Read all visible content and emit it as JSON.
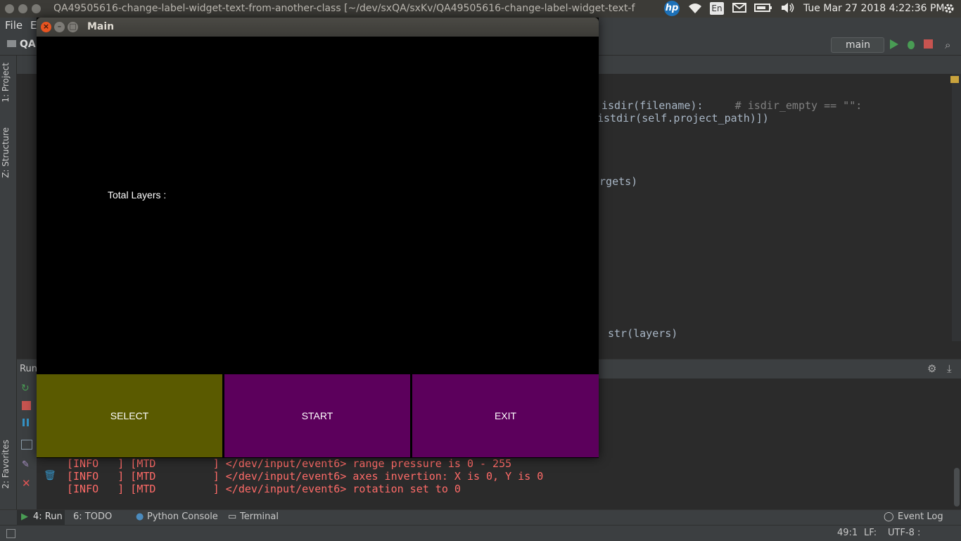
{
  "system_bar": {
    "window_title": "QA49505616-change-label-widget-text-from-another-class [~/dev/sxQA/sxKv/QA49505616-change-label-widget-text-f",
    "hp_logo": "hp",
    "lang": "En",
    "clock": "Tue Mar 27 2018  4:22:36 PM"
  },
  "ide": {
    "menu": {
      "file": "File",
      "edit": "E"
    },
    "project_crumb": "QA",
    "run_config": "main",
    "left_tabs": {
      "project": "1: Project",
      "structure": "Z: Structure",
      "favorites": "2: Favorites"
    },
    "code_lines": [
      {
        "text": "isdir(filename):     ",
        "comment": "# isdir_empty == \"\":"
      },
      {
        "text": "istdir(self.project_path)])",
        "comment": ""
      },
      {
        "text": "argets)",
        "comment": ""
      },
      {
        "text": "str(layers)",
        "comment": ""
      }
    ],
    "run_label": "Run",
    "log_lines": [
      "[INFO   ] [MTD         ] </dev/input/event6> range pressure is 0 - 255",
      "[INFO   ] [MTD         ] </dev/input/event6> axes invertion: X is 0, Y is 0",
      "[INFO   ] [MTD         ] </dev/input/event6> rotation set to 0"
    ],
    "bottom_tabs": {
      "run": "4: Run",
      "todo": "6: TODO",
      "python_console": "Python Console",
      "terminal": "Terminal",
      "event_log": "Event Log"
    },
    "status": {
      "position": "49:1",
      "line_sep": "LF:",
      "encoding": "UTF-8 :"
    }
  },
  "kivy_window": {
    "title": "Main",
    "label_text": "Total Layers :",
    "buttons": {
      "select": "SELECT",
      "start": "START",
      "exit": "EXIT"
    },
    "colors": {
      "select": "#5a5a00",
      "start": "#5c005c",
      "exit": "#5c005c",
      "background": "#000000"
    }
  }
}
